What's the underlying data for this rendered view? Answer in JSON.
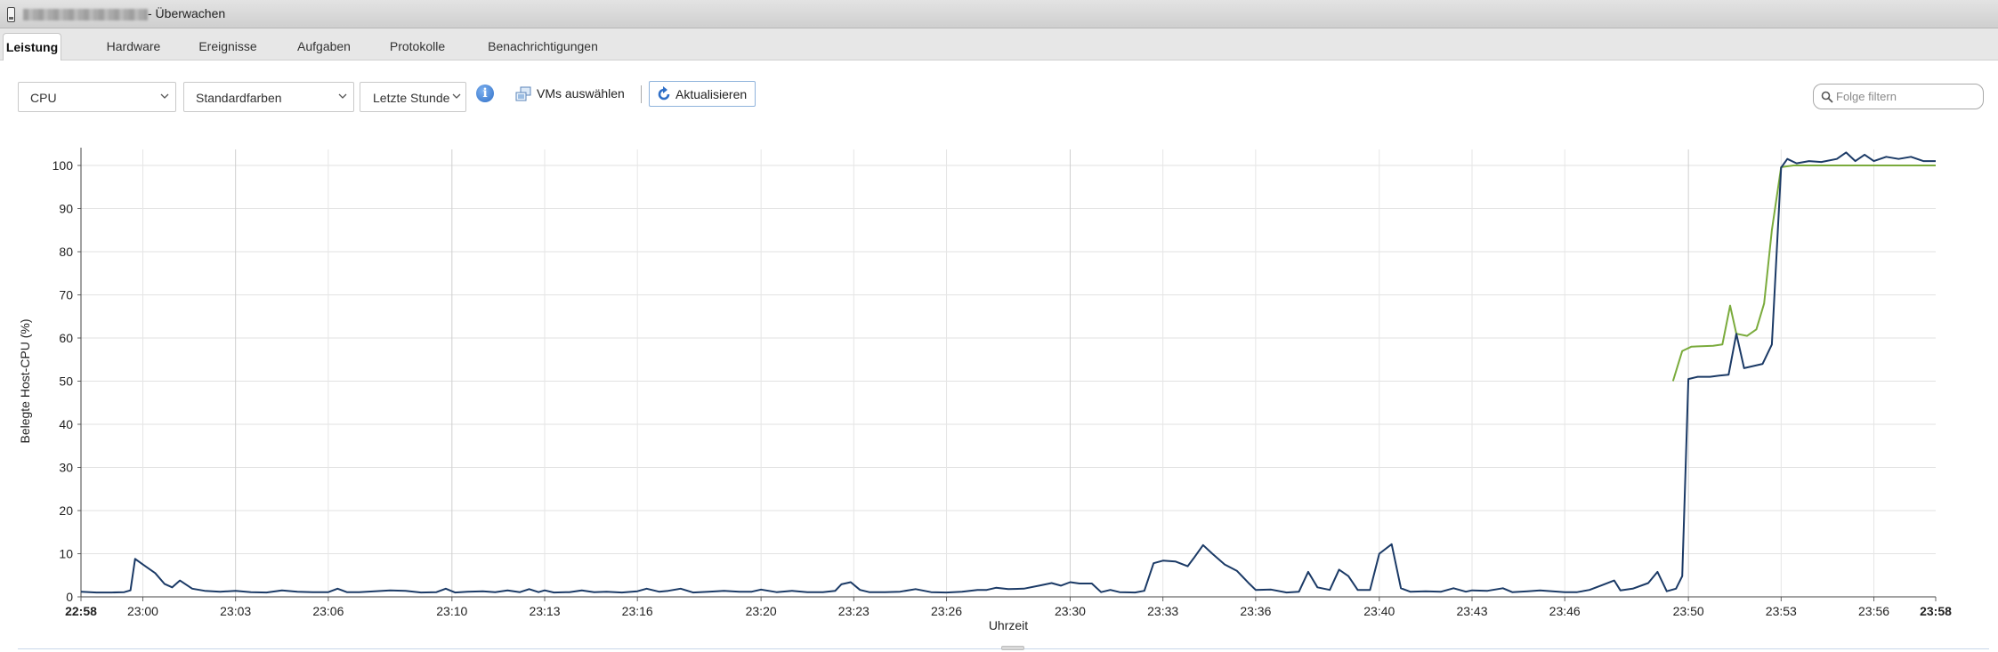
{
  "window": {
    "title_suffix": "- Überwachen"
  },
  "tabs": [
    {
      "label": "Leistung",
      "active": true
    },
    {
      "label": "Hardware"
    },
    {
      "label": "Ereignisse"
    },
    {
      "label": "Aufgaben"
    },
    {
      "label": "Protokolle"
    },
    {
      "label": "Benachrichtigungen"
    }
  ],
  "toolbar": {
    "metric": "CPU",
    "colors": "Standardfarben",
    "period": "Letzte Stunde",
    "vm_select_label": "VMs auswählen",
    "refresh_label": "Aktualisieren",
    "filter_placeholder": "Folge filtern"
  },
  "icons": {
    "info": "info-icon",
    "vm": "vm-select-icon",
    "refresh": "refresh-icon",
    "search": "search-icon",
    "dropdown": "chevron-down-icon"
  },
  "colors": {
    "navy_series": "#1b3a66",
    "green_series": "#7aab3c",
    "accent_border": "#8fb3dc"
  },
  "chart_data": {
    "type": "line",
    "xlabel": "Uhrzeit",
    "ylabel": "Belegte Host-CPU (%)",
    "ylim": [
      0,
      105
    ],
    "yticks": [
      0,
      10,
      20,
      30,
      40,
      50,
      60,
      70,
      80,
      90,
      100
    ],
    "xlim": [
      "22:58",
      "23:58"
    ],
    "xticks": [
      {
        "label": "22:58",
        "t": 0,
        "bold": true
      },
      {
        "label": "23:00",
        "t": 2
      },
      {
        "label": "23:03",
        "t": 5
      },
      {
        "label": "23:06",
        "t": 8
      },
      {
        "label": "23:10",
        "t": 12
      },
      {
        "label": "23:13",
        "t": 15
      },
      {
        "label": "23:16",
        "t": 18
      },
      {
        "label": "23:20",
        "t": 22
      },
      {
        "label": "23:23",
        "t": 25
      },
      {
        "label": "23:26",
        "t": 28
      },
      {
        "label": "23:30",
        "t": 32
      },
      {
        "label": "23:33",
        "t": 35
      },
      {
        "label": "23:36",
        "t": 38
      },
      {
        "label": "23:40",
        "t": 42
      },
      {
        "label": "23:43",
        "t": 45
      },
      {
        "label": "23:46",
        "t": 48
      },
      {
        "label": "23:50",
        "t": 52
      },
      {
        "label": "23:53",
        "t": 55
      },
      {
        "label": "23:56",
        "t": 58
      },
      {
        "label": "23:58",
        "t": 60,
        "bold": true
      }
    ],
    "major_grid_t": [
      5,
      12,
      32,
      52
    ],
    "grid": true,
    "legend": "none",
    "series": [
      {
        "color": "#7aab3c",
        "points": [
          [
            51.5,
            50
          ],
          [
            51.8,
            57
          ],
          [
            52.1,
            58
          ],
          [
            52.8,
            58.2
          ],
          [
            53.1,
            58.5
          ],
          [
            53.35,
            67.5
          ],
          [
            53.55,
            61
          ],
          [
            53.9,
            60.5
          ],
          [
            54.2,
            62
          ],
          [
            54.45,
            68
          ],
          [
            54.7,
            85
          ],
          [
            55.0,
            99.6
          ],
          [
            55.4,
            100
          ],
          [
            60.0,
            100
          ]
        ]
      },
      {
        "color": "#1b3a66",
        "points": [
          [
            0.0,
            1.2
          ],
          [
            0.5,
            1.0
          ],
          [
            1.0,
            1.0
          ],
          [
            1.4,
            1.1
          ],
          [
            1.6,
            1.5
          ],
          [
            1.75,
            8.8
          ],
          [
            2.0,
            7.5
          ],
          [
            2.4,
            5.5
          ],
          [
            2.7,
            3.0
          ],
          [
            2.95,
            2.2
          ],
          [
            3.2,
            3.8
          ],
          [
            3.6,
            1.9
          ],
          [
            4.0,
            1.4
          ],
          [
            4.5,
            1.2
          ],
          [
            5.0,
            1.4
          ],
          [
            5.5,
            1.1
          ],
          [
            6.0,
            1.0
          ],
          [
            6.5,
            1.5
          ],
          [
            7.0,
            1.2
          ],
          [
            7.5,
            1.1
          ],
          [
            8.0,
            1.1
          ],
          [
            8.3,
            1.9
          ],
          [
            8.6,
            1.1
          ],
          [
            9.0,
            1.1
          ],
          [
            9.5,
            1.3
          ],
          [
            10.0,
            1.5
          ],
          [
            10.5,
            1.4
          ],
          [
            11.0,
            1.0
          ],
          [
            11.5,
            1.1
          ],
          [
            11.8,
            1.9
          ],
          [
            12.1,
            1.0
          ],
          [
            12.5,
            1.2
          ],
          [
            13.0,
            1.3
          ],
          [
            13.4,
            1.1
          ],
          [
            13.8,
            1.5
          ],
          [
            14.2,
            1.1
          ],
          [
            14.5,
            1.8
          ],
          [
            14.8,
            1.1
          ],
          [
            15.0,
            1.5
          ],
          [
            15.3,
            1.0
          ],
          [
            15.8,
            1.1
          ],
          [
            16.2,
            1.5
          ],
          [
            16.6,
            1.1
          ],
          [
            17.0,
            1.2
          ],
          [
            17.5,
            1.0
          ],
          [
            18.0,
            1.3
          ],
          [
            18.3,
            1.9
          ],
          [
            18.7,
            1.2
          ],
          [
            19.0,
            1.4
          ],
          [
            19.4,
            1.9
          ],
          [
            19.8,
            1.0
          ],
          [
            20.3,
            1.2
          ],
          [
            20.8,
            1.4
          ],
          [
            21.3,
            1.2
          ],
          [
            21.7,
            1.2
          ],
          [
            22.0,
            1.7
          ],
          [
            22.5,
            1.1
          ],
          [
            23.0,
            1.4
          ],
          [
            23.5,
            1.1
          ],
          [
            24.0,
            1.1
          ],
          [
            24.4,
            1.4
          ],
          [
            24.6,
            2.9
          ],
          [
            24.9,
            3.4
          ],
          [
            25.2,
            1.6
          ],
          [
            25.5,
            1.1
          ],
          [
            26.0,
            1.1
          ],
          [
            26.5,
            1.2
          ],
          [
            27.0,
            1.8
          ],
          [
            27.5,
            1.1
          ],
          [
            28.0,
            1.0
          ],
          [
            28.5,
            1.2
          ],
          [
            29.0,
            1.6
          ],
          [
            29.3,
            1.6
          ],
          [
            29.6,
            2.1
          ],
          [
            30.0,
            1.8
          ],
          [
            30.5,
            1.9
          ],
          [
            31.0,
            2.6
          ],
          [
            31.4,
            3.2
          ],
          [
            31.7,
            2.6
          ],
          [
            32.0,
            3.4
          ],
          [
            32.3,
            3.1
          ],
          [
            32.7,
            3.1
          ],
          [
            33.0,
            1.1
          ],
          [
            33.3,
            1.6
          ],
          [
            33.6,
            1.1
          ],
          [
            34.1,
            1.0
          ],
          [
            34.4,
            1.4
          ],
          [
            34.7,
            7.8
          ],
          [
            35.0,
            8.4
          ],
          [
            35.4,
            8.2
          ],
          [
            35.8,
            7.1
          ],
          [
            36.0,
            9.0
          ],
          [
            36.3,
            12.0
          ],
          [
            36.6,
            10.0
          ],
          [
            37.0,
            7.5
          ],
          [
            37.4,
            6.0
          ],
          [
            37.8,
            3.0
          ],
          [
            38.0,
            1.6
          ],
          [
            38.5,
            1.7
          ],
          [
            39.0,
            1.0
          ],
          [
            39.4,
            1.2
          ],
          [
            39.7,
            5.8
          ],
          [
            40.0,
            2.2
          ],
          [
            40.4,
            1.6
          ],
          [
            40.7,
            6.3
          ],
          [
            41.0,
            4.8
          ],
          [
            41.3,
            1.6
          ],
          [
            41.7,
            1.6
          ],
          [
            42.0,
            10.0
          ],
          [
            42.4,
            12.2
          ],
          [
            42.7,
            2.0
          ],
          [
            43.0,
            1.2
          ],
          [
            43.5,
            1.3
          ],
          [
            44.0,
            1.2
          ],
          [
            44.4,
            2.0
          ],
          [
            44.8,
            1.2
          ],
          [
            45.0,
            1.5
          ],
          [
            45.5,
            1.4
          ],
          [
            46.0,
            2.0
          ],
          [
            46.3,
            1.1
          ],
          [
            46.8,
            1.3
          ],
          [
            47.2,
            1.5
          ],
          [
            47.6,
            1.3
          ],
          [
            48.0,
            1.1
          ],
          [
            48.4,
            1.1
          ],
          [
            48.8,
            1.6
          ],
          [
            49.2,
            2.7
          ],
          [
            49.6,
            3.8
          ],
          [
            49.8,
            1.5
          ],
          [
            50.2,
            1.9
          ],
          [
            50.7,
            3.2
          ],
          [
            51.0,
            5.8
          ],
          [
            51.3,
            1.3
          ],
          [
            51.6,
            1.9
          ],
          [
            51.8,
            4.8
          ],
          [
            52.0,
            50.5
          ],
          [
            52.3,
            51.0
          ],
          [
            52.7,
            51.0
          ],
          [
            53.0,
            51.3
          ],
          [
            53.3,
            51.5
          ],
          [
            53.55,
            61.0
          ],
          [
            53.8,
            53.0
          ],
          [
            54.1,
            53.5
          ],
          [
            54.4,
            54.0
          ],
          [
            54.7,
            58.5
          ],
          [
            55.0,
            99.5
          ],
          [
            55.2,
            101.5
          ],
          [
            55.5,
            100.5
          ],
          [
            55.9,
            101.0
          ],
          [
            56.3,
            100.8
          ],
          [
            56.8,
            101.5
          ],
          [
            57.1,
            103.0
          ],
          [
            57.4,
            101.0
          ],
          [
            57.7,
            102.5
          ],
          [
            58.0,
            101.0
          ],
          [
            58.4,
            102.0
          ],
          [
            58.8,
            101.5
          ],
          [
            59.2,
            102.0
          ],
          [
            59.6,
            101.0
          ],
          [
            60.0,
            101.0
          ]
        ]
      }
    ]
  }
}
